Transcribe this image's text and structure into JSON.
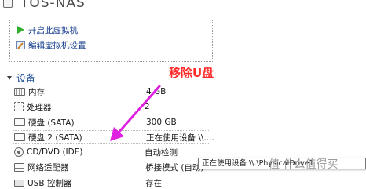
{
  "header": {
    "title": "TOS-NAS"
  },
  "actions": [
    {
      "label": "开启此虚拟机",
      "icon": "play-icon"
    },
    {
      "label": "编辑虚拟机设置",
      "icon": "edit-icon"
    }
  ],
  "devices_section": {
    "title": "设备",
    "items": [
      {
        "name": "内存",
        "value": "4 GB",
        "icon": "memory-icon"
      },
      {
        "name": "处理器",
        "value": "2",
        "icon": "processor-icon"
      },
      {
        "name": "硬盘 (SATA)",
        "value": "300 GB",
        "icon": "hard-disk-icon"
      },
      {
        "name": "硬盘 2 (SATA)",
        "value": "正在使用设备 \\\\....",
        "icon": "hard-disk-icon"
      },
      {
        "name": "CD/DVD (IDE)",
        "value": "自动检测",
        "icon": "cd-dvd-icon"
      },
      {
        "name": "网络适配器",
        "value": "桥接模式 (自动)",
        "icon": "network-adapter-icon"
      },
      {
        "name": "USB 控制器",
        "value": "存在",
        "icon": "usb-controller-icon"
      }
    ]
  },
  "annotation": {
    "text": "移除U盘",
    "color": "#ff2a2a"
  },
  "tooltip": {
    "text": "正在使用设备 \\\\.\\PhysicalDrive1"
  },
  "watermark": {
    "text": "值 什么值得买"
  }
}
